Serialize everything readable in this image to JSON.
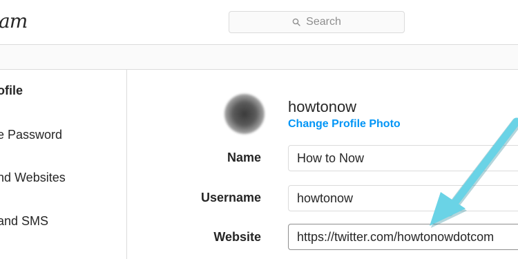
{
  "header": {
    "logo_text": "am",
    "search_placeholder": "Search"
  },
  "sidebar": {
    "items": [
      {
        "label": "ofile",
        "active": true
      },
      {
        "label": "e Password",
        "active": false
      },
      {
        "label": "nd Websites",
        "active": false
      },
      {
        "label": "and SMS",
        "active": false
      }
    ]
  },
  "profile": {
    "username": "howtonow",
    "change_photo_label": "Change Profile Photo"
  },
  "form": {
    "name_label": "Name",
    "name_value": "How to Now",
    "username_label": "Username",
    "username_value": "howtonow",
    "website_label": "Website",
    "website_value": "https://twitter.com/howtonowdotcom"
  },
  "annotation": {
    "arrow_color": "#6ad3e6"
  },
  "colors": {
    "link": "#0095f6",
    "border": "#dbdbdb"
  }
}
